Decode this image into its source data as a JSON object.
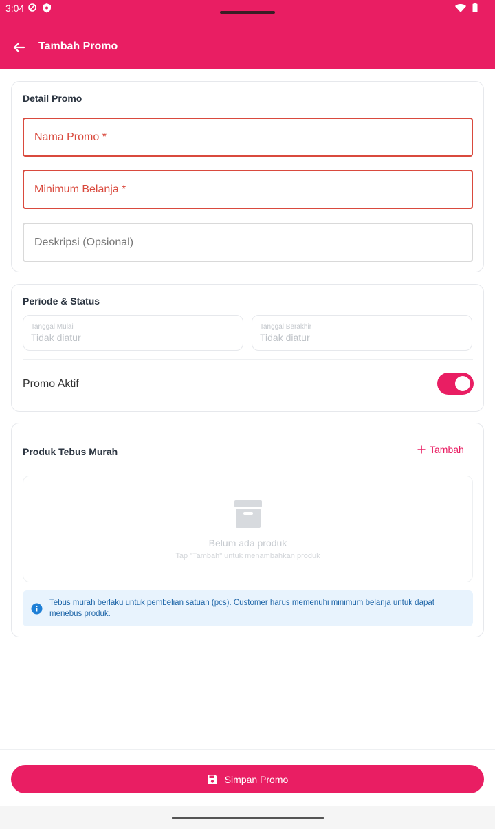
{
  "status": {
    "time": "3:04"
  },
  "appbar": {
    "title": "Tambah Promo"
  },
  "detail": {
    "title": "Detail Promo",
    "name_label": "Nama Promo *",
    "min_label": "Minimum Belanja *",
    "desc_label": "Deskripsi (Opsional)"
  },
  "period": {
    "title": "Periode & Status",
    "start_label": "Tanggal Mulai",
    "start_value": "Tidak diatur",
    "end_label": "Tanggal Berakhir",
    "end_value": "Tidak diatur",
    "active_label": "Promo Aktif"
  },
  "products": {
    "title": "Produk Tebus Murah",
    "add_label": "Tambah",
    "empty_title": "Belum ada produk",
    "empty_sub": "Tap \"Tambah\" untuk menambahkan produk",
    "info": "Tebus murah berlaku untuk pembelian satuan (pcs). Customer harus memenuhi minimum belanja untuk dapat menebus produk."
  },
  "footer": {
    "save_label": "Simpan Promo"
  },
  "colors": {
    "primary": "#E91E63",
    "error": "#D94A3E",
    "info_bg": "#E8F3FD",
    "info_text": "#1F66A8"
  }
}
